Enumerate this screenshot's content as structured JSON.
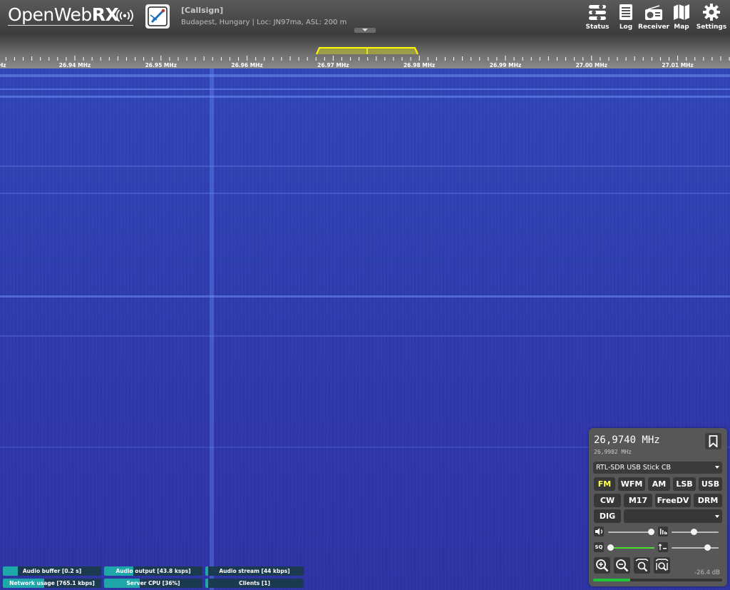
{
  "header": {
    "logo_text_regular": "OpenWeb",
    "logo_text_bold": "RX",
    "receiver_name": "[Callsign]",
    "receiver_description": "Budapest, Hungary | Loc: JN97ma, ASL: 200 m",
    "nav": [
      {
        "label": "Status",
        "icon": "status-icon"
      },
      {
        "label": "Log",
        "icon": "log-icon"
      },
      {
        "label": "Receiver",
        "icon": "radio-icon"
      },
      {
        "label": "Map",
        "icon": "map-icon"
      },
      {
        "label": "Settings",
        "icon": "gear-icon"
      }
    ]
  },
  "scale": {
    "edge_label": "Hz",
    "labels": [
      "26.94 MHz",
      "26.95 MHz",
      "26.96 MHz",
      "26.97 MHz",
      "26.98 MHz",
      "26.99 MHz",
      "27.00 MHz",
      "27.01 MHz"
    ],
    "passband_color": "#ffff00"
  },
  "receiver_panel": {
    "frequency": "26,9740 MHz",
    "offset_frequency": "26,9982 MHz",
    "profile": "RTL-SDR USB Stick CB",
    "modes_row1": [
      "FM",
      "WFM",
      "AM",
      "LSB",
      "USB"
    ],
    "modes_row2": [
      "CW",
      "M17",
      "FreeDV",
      "DRM"
    ],
    "dig_label": "DIG",
    "active_mode": "FM",
    "squelch_label": "SQ",
    "volume_level": 0.93,
    "squelch_level": 0.0,
    "nr_level": 0.55,
    "agc_level": 0.88,
    "smeter_db": "-26.4 dB",
    "smeter_level": 0.29
  },
  "status_bars": [
    {
      "label": "Audio buffer [0.2 s]",
      "level": 0.15
    },
    {
      "label": "Audio output [43.8 ksps]",
      "level": 0.3
    },
    {
      "label": "Audio stream [44 kbps]",
      "level": 0.03
    },
    {
      "label": "Network usage [765.1 kbps]",
      "level": 0.42
    },
    {
      "label": "Server CPU [36%]",
      "level": 0.36
    },
    {
      "label": "Clients [1]",
      "level": 0.03
    }
  ],
  "colors": {
    "waterfall_base": "#2f36a9",
    "accent_yellow": "#ffff50",
    "status_fill": "#1ea6a9",
    "smeter_green": "#20c43a"
  }
}
